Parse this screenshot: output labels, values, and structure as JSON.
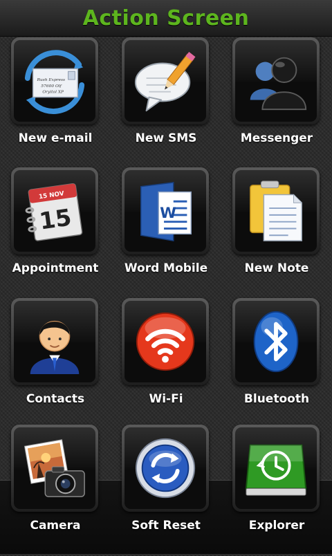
{
  "header": {
    "title": "Action Screen"
  },
  "tiles": [
    {
      "label": "New e-mail",
      "icon": "email-envelope-icon"
    },
    {
      "label": "New SMS",
      "icon": "sms-bubble-icon"
    },
    {
      "label": "Messenger",
      "icon": "messenger-people-icon"
    },
    {
      "label": "Appointment",
      "icon": "calendar-icon"
    },
    {
      "label": "Word Mobile",
      "icon": "word-document-icon"
    },
    {
      "label": "New Note",
      "icon": "note-icon"
    },
    {
      "label": "Contacts",
      "icon": "contact-person-icon"
    },
    {
      "label": "Wi-Fi",
      "icon": "wifi-icon"
    },
    {
      "label": "Bluetooth",
      "icon": "bluetooth-icon"
    },
    {
      "label": "Camera",
      "icon": "camera-icon"
    },
    {
      "label": "Soft Reset",
      "icon": "refresh-icon"
    },
    {
      "label": "Explorer",
      "icon": "drive-clock-icon"
    }
  ],
  "icons": {
    "envelope_text": [
      "Rush Express",
      "57600 Olf",
      "Oryitol XP"
    ],
    "calendar_month": "15 NOV",
    "calendar_day": "15",
    "word_letter": "W"
  },
  "colors": {
    "title_green": "#5db51e",
    "wifi_red": "#e5381c",
    "bluetooth_blue": "#1e64c8",
    "explorer_green": "#2f9a24"
  }
}
